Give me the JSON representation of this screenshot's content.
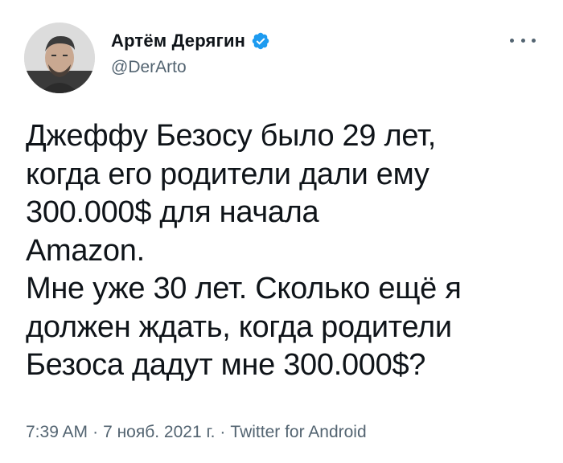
{
  "author": {
    "display_name": "Артём Дерягин",
    "handle": "@DerArto",
    "verified_color": "#1d9bf0"
  },
  "icons": {
    "verified": "verified-badge-icon",
    "more": "more-options-icon"
  },
  "tweet": {
    "lines": [
      "Джеффу Безосу было 29 лет,",
      "когда его родители дали ему",
      "300.000$ для начала",
      "Amazon.",
      "Мне уже 30 лет. Сколько ещё я",
      "должен ждать, когда родители",
      "Безоса дадут мне 300.000$?"
    ]
  },
  "meta": {
    "time": "7:39 AM",
    "date": "7 нояб. 2021 г.",
    "source": "Twitter for Android",
    "separator": "·"
  }
}
